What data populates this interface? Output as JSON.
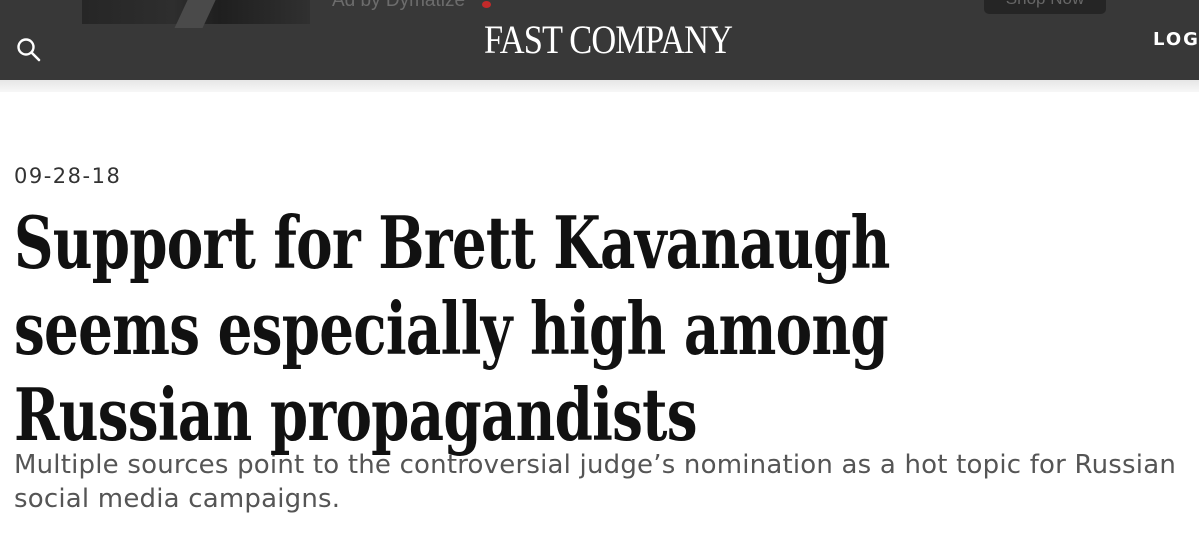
{
  "header": {
    "ad_text": "Ad by Dymatize",
    "ad_button_label": "Shop Now",
    "logo_text": "FAST COMPANY",
    "login_label": "LOG"
  },
  "icons": {
    "search": "search-icon"
  },
  "article": {
    "date": "09-28-18",
    "headline": "Support for Brett Kavanaugh seems especially high among Russian propagandists",
    "dek": "Multiple sources point to the controversial judge’s nomination as a hot topic for Russian social media campaigns."
  },
  "colors": {
    "header_bg": "#383838",
    "page_bg": "#ffffff",
    "headline": "#111111",
    "dek": "#555555"
  }
}
